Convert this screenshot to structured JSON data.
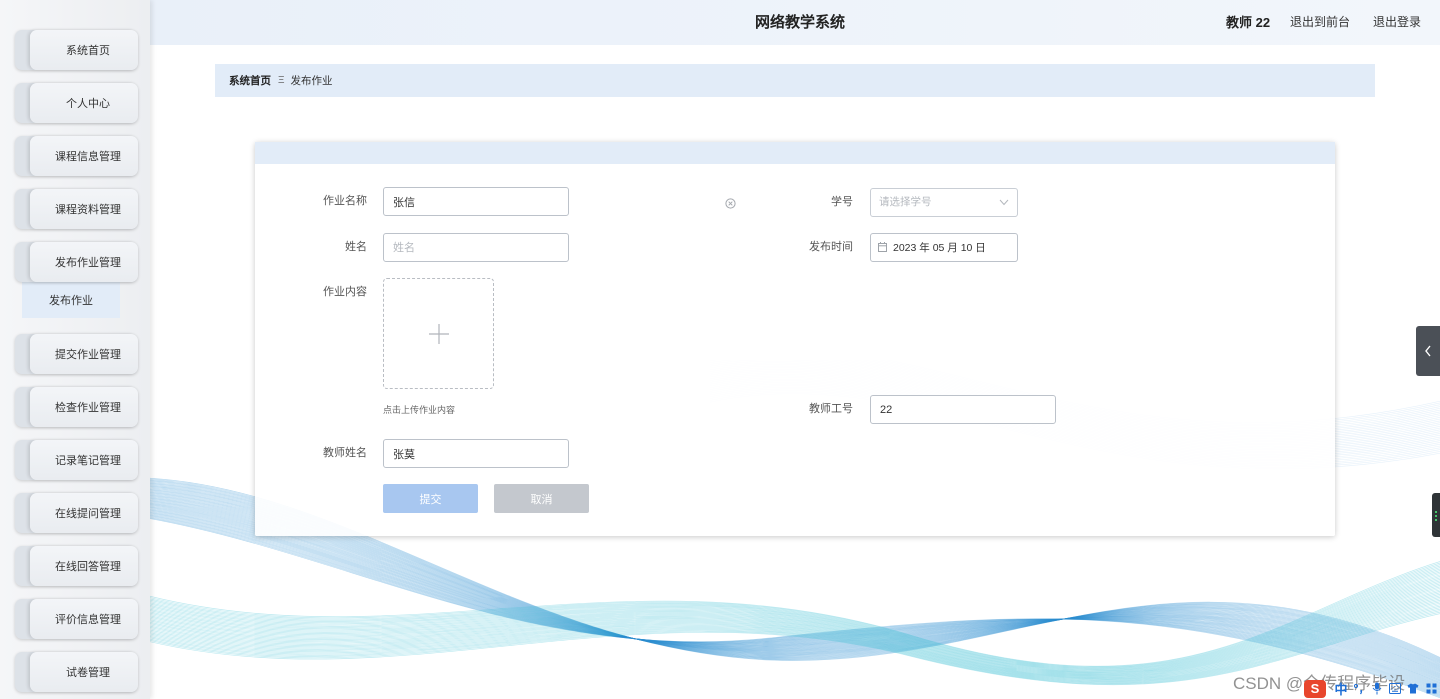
{
  "app": {
    "title": "网络教学系统"
  },
  "header": {
    "user": "教师 22",
    "to_front": "退出到前台",
    "logout": "退出登录"
  },
  "sidebar": {
    "items": [
      {
        "label": "系统首页"
      },
      {
        "label": "个人中心"
      },
      {
        "label": "课程信息管理"
      },
      {
        "label": "课程资料管理"
      },
      {
        "label": "发布作业管理",
        "expanded": true,
        "children": [
          {
            "label": "发布作业",
            "active": true
          }
        ]
      },
      {
        "label": "提交作业管理"
      },
      {
        "label": "检查作业管理"
      },
      {
        "label": "记录笔记管理"
      },
      {
        "label": "在线提问管理"
      },
      {
        "label": "在线回答管理"
      },
      {
        "label": "评价信息管理"
      },
      {
        "label": "试卷管理"
      }
    ]
  },
  "breadcrumb": {
    "home": "系统首页",
    "separator": "Ξ",
    "current": "发布作业"
  },
  "form": {
    "homework_name": {
      "label": "作业名称",
      "value": "张信"
    },
    "student_no": {
      "label": "学号",
      "placeholder": "请选择学号"
    },
    "student_name": {
      "label": "姓名",
      "placeholder": "姓名"
    },
    "publish_time": {
      "label": "发布时间",
      "value": "2023 年 05 月 10 日"
    },
    "homework_content": {
      "label": "作业内容",
      "upload_hint": "点击上传作业内容"
    },
    "teacher_no": {
      "label": "教师工号",
      "value": "22"
    },
    "teacher_name": {
      "label": "教师姓名",
      "value": "张莫"
    },
    "submit_label": "提交",
    "cancel_label": "取消"
  },
  "icons": {
    "clear": "circle-close-icon",
    "select_arrow": "chevron-down-icon",
    "calendar": "calendar-icon",
    "upload": "plus-icon",
    "collapse": "chevron-left-icon"
  },
  "colors": {
    "primary_button": "#a8c7f0",
    "cancel_button": "#c4c8ce",
    "panel_tint": "#e2ecf8",
    "wave_blue": "#2f8ed2",
    "wave_cyan": "#3fc0d4"
  },
  "watermark": "CSDN @全传程序毕设",
  "ime": {
    "logo": "S",
    "mode": "中"
  }
}
